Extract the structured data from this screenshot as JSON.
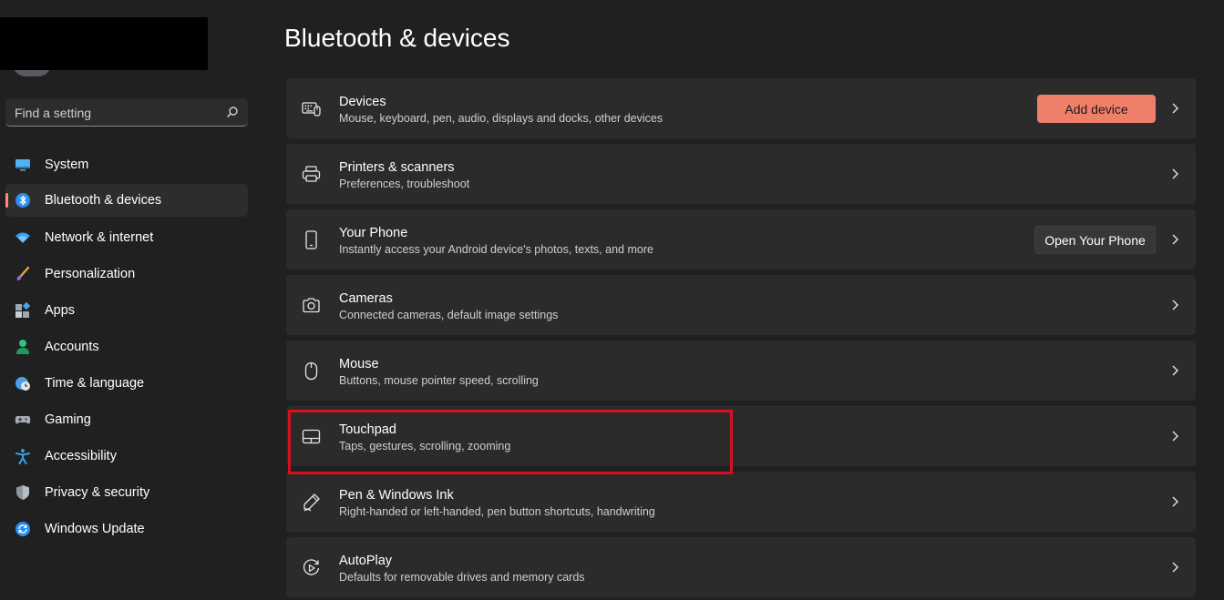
{
  "colors": {
    "accent": "#f07f6a",
    "highlight": "#d7101f",
    "background": "#202020",
    "card": "#2b2b2b"
  },
  "search": {
    "placeholder": "Find a setting",
    "icon": "search-icon"
  },
  "sidebar": {
    "items": [
      {
        "label": "System",
        "icon": "monitor-icon"
      },
      {
        "label": "Bluetooth & devices",
        "icon": "bluetooth-icon",
        "active": true
      },
      {
        "label": "Network & internet",
        "icon": "wifi-icon"
      },
      {
        "label": "Personalization",
        "icon": "brush-icon"
      },
      {
        "label": "Apps",
        "icon": "apps-icon"
      },
      {
        "label": "Accounts",
        "icon": "person-icon"
      },
      {
        "label": "Time & language",
        "icon": "globe-clock-icon"
      },
      {
        "label": "Gaming",
        "icon": "gamepad-icon"
      },
      {
        "label": "Accessibility",
        "icon": "accessibility-icon"
      },
      {
        "label": "Privacy & security",
        "icon": "shield-icon"
      },
      {
        "label": "Windows Update",
        "icon": "update-icon"
      }
    ]
  },
  "main": {
    "title": "Bluetooth & devices",
    "cards": [
      {
        "title": "Devices",
        "subtitle": "Mouse, keyboard, pen, audio, displays and docks, other devices",
        "icon": "keyboard-devices-icon",
        "button": "Add device"
      },
      {
        "title": "Printers & scanners",
        "subtitle": "Preferences, troubleshoot",
        "icon": "printer-icon"
      },
      {
        "title": "Your Phone",
        "subtitle": "Instantly access your Android device's photos, texts, and more",
        "icon": "phone-icon",
        "button": "Open Your Phone"
      },
      {
        "title": "Cameras",
        "subtitle": "Connected cameras, default image settings",
        "icon": "camera-icon"
      },
      {
        "title": "Mouse",
        "subtitle": "Buttons, mouse pointer speed, scrolling",
        "icon": "mouse-icon"
      },
      {
        "title": "Touchpad",
        "subtitle": "Taps, gestures, scrolling, zooming",
        "icon": "touchpad-icon",
        "highlighted": true
      },
      {
        "title": "Pen & Windows Ink",
        "subtitle": "Right-handed or left-handed, pen button shortcuts, handwriting",
        "icon": "pen-icon"
      },
      {
        "title": "AutoPlay",
        "subtitle": "Defaults for removable drives and memory cards",
        "icon": "autoplay-icon"
      }
    ]
  }
}
